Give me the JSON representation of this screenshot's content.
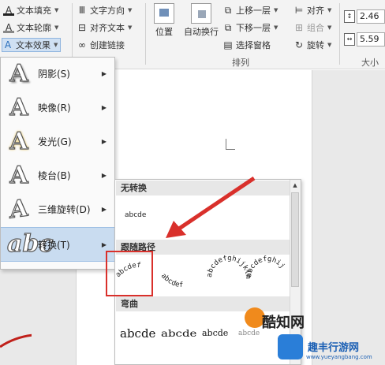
{
  "ribbon": {
    "text_fill": "文本填充",
    "text_outline": "文本轮廓",
    "text_effect": "文本效果",
    "text_direction": "文字方向",
    "align_text": "对齐文本",
    "create_link": "创建链接",
    "position": "位置",
    "wrap_text": "自动换行",
    "bring_forward": "上移一层",
    "send_backward": "下移一层",
    "selection_pane": "选择窗格",
    "align": "对齐",
    "group": "组合",
    "rotate": "旋转",
    "arrange_label": "排列",
    "size_label": "大小",
    "height_value": "2.46",
    "width_value": "5.59"
  },
  "menu": {
    "items": [
      {
        "label": "阴影(S)",
        "icon": "A"
      },
      {
        "label": "映像(R)",
        "icon": "A"
      },
      {
        "label": "发光(G)",
        "icon": "A"
      },
      {
        "label": "棱台(B)",
        "icon": "A"
      },
      {
        "label": "三维旋转(D)",
        "icon": "A"
      },
      {
        "label": "转换(T)",
        "icon": "abc"
      }
    ]
  },
  "submenu": {
    "no_transform": "无转换",
    "plain_sample": "abcde",
    "follow_path": "跟随路径",
    "arch_sample": "abcdef",
    "circle_sample": "abcdefghijklm",
    "button_sample": "abcdefghij",
    "warp": "弯曲",
    "warp_samples": [
      "abcde",
      "abcde",
      "abcde",
      "abcde"
    ]
  },
  "watermarks": {
    "logo1": "酷知网",
    "logo2": "趣丰行游网",
    "logo2_url": "www.yueyangbang.com"
  },
  "colors": {
    "menu_highlight": "#c9dcf0",
    "annotation_red": "#d9302b"
  }
}
